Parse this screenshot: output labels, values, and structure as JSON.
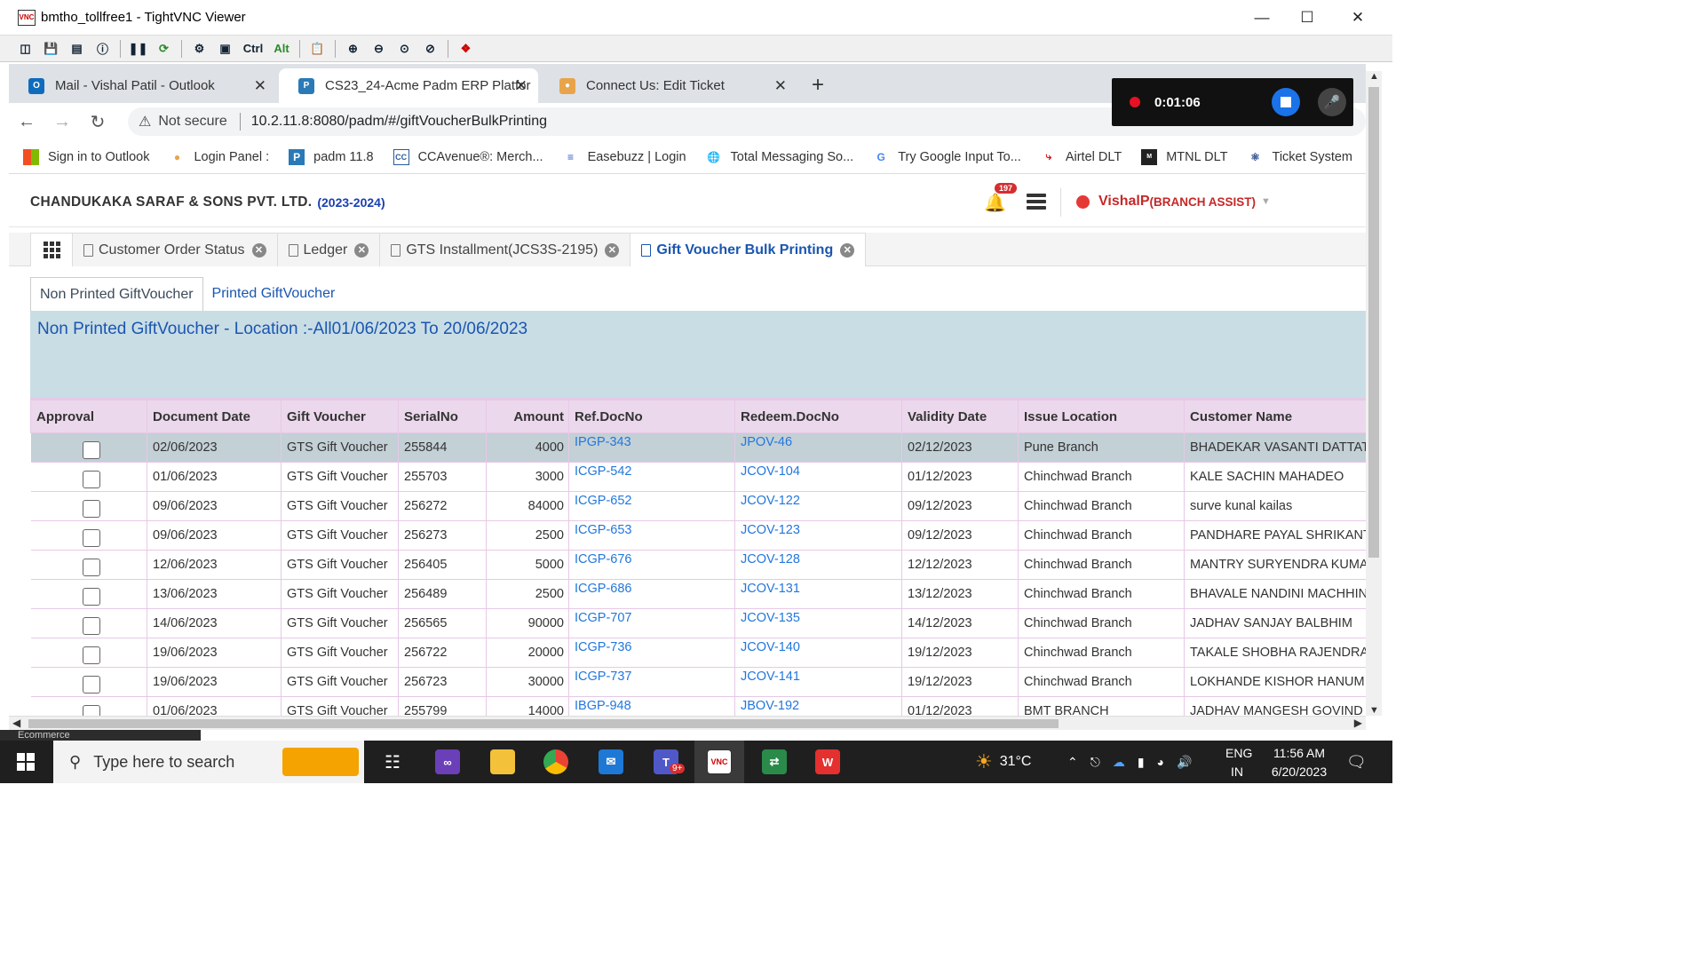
{
  "window": {
    "title": "bmtho_tollfree1 - TightVNC Viewer",
    "vnc_logo": "VNC"
  },
  "vnc_toolbar": {
    "ctrl_label": "Ctrl",
    "alt_label": "Alt"
  },
  "browser": {
    "tabs": [
      {
        "label": "Mail - Vishal Patil - Outlook",
        "icon": "outlook-icon",
        "color": "#0f6cbd"
      },
      {
        "label": "CS23_24-Acme Padm ERP Platfor",
        "icon": "padm-icon",
        "color": "#2a7ab8"
      },
      {
        "label": "Connect Us: Edit Ticket",
        "icon": "ticket-icon",
        "color": "#e8a44a"
      }
    ],
    "security_label": "Not secure",
    "url": "10.2.11.8:8080/padm/#/giftVoucherBulkPrinting",
    "bookmarks": [
      {
        "label": "Sign in to Outlook",
        "icon": "microsoft-icon"
      },
      {
        "label": "Login Panel :",
        "icon": "login-icon"
      },
      {
        "label": "padm 11.8",
        "icon": "padm-icon"
      },
      {
        "label": "CCAvenue®: Merch...",
        "icon": "ccavenue-icon"
      },
      {
        "label": "Easebuzz | Login",
        "icon": "easebuzz-icon"
      },
      {
        "label": "Total Messaging So...",
        "icon": "globe-icon"
      },
      {
        "label": "Try Google Input To...",
        "icon": "google-icon"
      },
      {
        "label": "Airtel DLT",
        "icon": "airtel-icon"
      },
      {
        "label": "MTNL DLT",
        "icon": "mtnl-icon"
      },
      {
        "label": "Ticket System",
        "icon": "react-icon"
      }
    ]
  },
  "recorder": {
    "time": "0:01:06"
  },
  "app": {
    "company": "CHANDUKAKA SARAF & SONS PVT. LTD.",
    "fiscal_year": "(2023-2024)",
    "notification_count": "197",
    "user_name": "VishalP",
    "user_role": "(BRANCH ASSIST)",
    "tabs": [
      {
        "label": "Customer Order Status",
        "active": false
      },
      {
        "label": "Ledger",
        "active": false
      },
      {
        "label": "GTS Installment(JCS3S-2195)",
        "active": false
      },
      {
        "label": "Gift Voucher Bulk Printing",
        "active": true
      }
    ],
    "subtabs": [
      "Non Printed GiftVoucher",
      "Printed GiftVoucher"
    ],
    "banner_title": "Non Printed GiftVoucher - Location :-All01/06/2023 To 20/06/2023"
  },
  "table": {
    "headers": [
      "Approval",
      "Document Date",
      "Gift Voucher",
      "SerialNo",
      "Amount",
      "Ref.DocNo",
      "Redeem.DocNo",
      "Validity Date",
      "Issue Location",
      "Customer Name"
    ],
    "rows": [
      {
        "date": "02/06/2023",
        "voucher": "GTS Gift Voucher",
        "serial": "255844",
        "amount": "4000",
        "ref": "IPGP-343",
        "redeem": "JPOV-46",
        "validity": "02/12/2023",
        "location": "Pune Branch",
        "customer": "BHADEKAR VASANTI DATTAT"
      },
      {
        "date": "01/06/2023",
        "voucher": "GTS Gift Voucher",
        "serial": "255703",
        "amount": "3000",
        "ref": "ICGP-542",
        "redeem": "JCOV-104",
        "validity": "01/12/2023",
        "location": "Chinchwad Branch",
        "customer": "KALE SACHIN MAHADEO"
      },
      {
        "date": "09/06/2023",
        "voucher": "GTS Gift Voucher",
        "serial": "256272",
        "amount": "84000",
        "ref": "ICGP-652",
        "redeem": "JCOV-122",
        "validity": "09/12/2023",
        "location": "Chinchwad Branch",
        "customer": "surve kunal kailas"
      },
      {
        "date": "09/06/2023",
        "voucher": "GTS Gift Voucher",
        "serial": "256273",
        "amount": "2500",
        "ref": "ICGP-653",
        "redeem": "JCOV-123",
        "validity": "09/12/2023",
        "location": "Chinchwad Branch",
        "customer": "PANDHARE PAYAL SHRIKANT"
      },
      {
        "date": "12/06/2023",
        "voucher": "GTS Gift Voucher",
        "serial": "256405",
        "amount": "5000",
        "ref": "ICGP-676",
        "redeem": "JCOV-128",
        "validity": "12/12/2023",
        "location": "Chinchwad Branch",
        "customer": "MANTRY SURYENDRA KUMA"
      },
      {
        "date": "13/06/2023",
        "voucher": "GTS Gift Voucher",
        "serial": "256489",
        "amount": "2500",
        "ref": "ICGP-686",
        "redeem": "JCOV-131",
        "validity": "13/12/2023",
        "location": "Chinchwad Branch",
        "customer": "BHAVALE NANDINI MACHHIN"
      },
      {
        "date": "14/06/2023",
        "voucher": "GTS Gift Voucher",
        "serial": "256565",
        "amount": "90000",
        "ref": "ICGP-707",
        "redeem": "JCOV-135",
        "validity": "14/12/2023",
        "location": "Chinchwad Branch",
        "customer": "JADHAV SANJAY BALBHIM"
      },
      {
        "date": "19/06/2023",
        "voucher": "GTS Gift Voucher",
        "serial": "256722",
        "amount": "20000",
        "ref": "ICGP-736",
        "redeem": "JCOV-140",
        "validity": "19/12/2023",
        "location": "Chinchwad Branch",
        "customer": "TAKALE SHOBHA RAJENDRA"
      },
      {
        "date": "19/06/2023",
        "voucher": "GTS Gift Voucher",
        "serial": "256723",
        "amount": "30000",
        "ref": "ICGP-737",
        "redeem": "JCOV-141",
        "validity": "19/12/2023",
        "location": "Chinchwad Branch",
        "customer": "LOKHANDE KISHOR HANUM"
      },
      {
        "date": "01/06/2023",
        "voucher": "GTS Gift Voucher",
        "serial": "255799",
        "amount": "14000",
        "ref": "IBGP-948",
        "redeem": "JBOV-192",
        "validity": "01/12/2023",
        "location": "BMT BRANCH",
        "customer": "JADHAV MANGESH GOVIND"
      }
    ]
  },
  "taskbar": {
    "hidden_window_label": "Ecommerce",
    "search_placeholder": "Type here to search",
    "temperature": "31°C",
    "lang_top": "ENG",
    "lang_bottom": "IN",
    "time": "11:56 AM",
    "date": "6/20/2023",
    "teams_badge": "9+"
  }
}
